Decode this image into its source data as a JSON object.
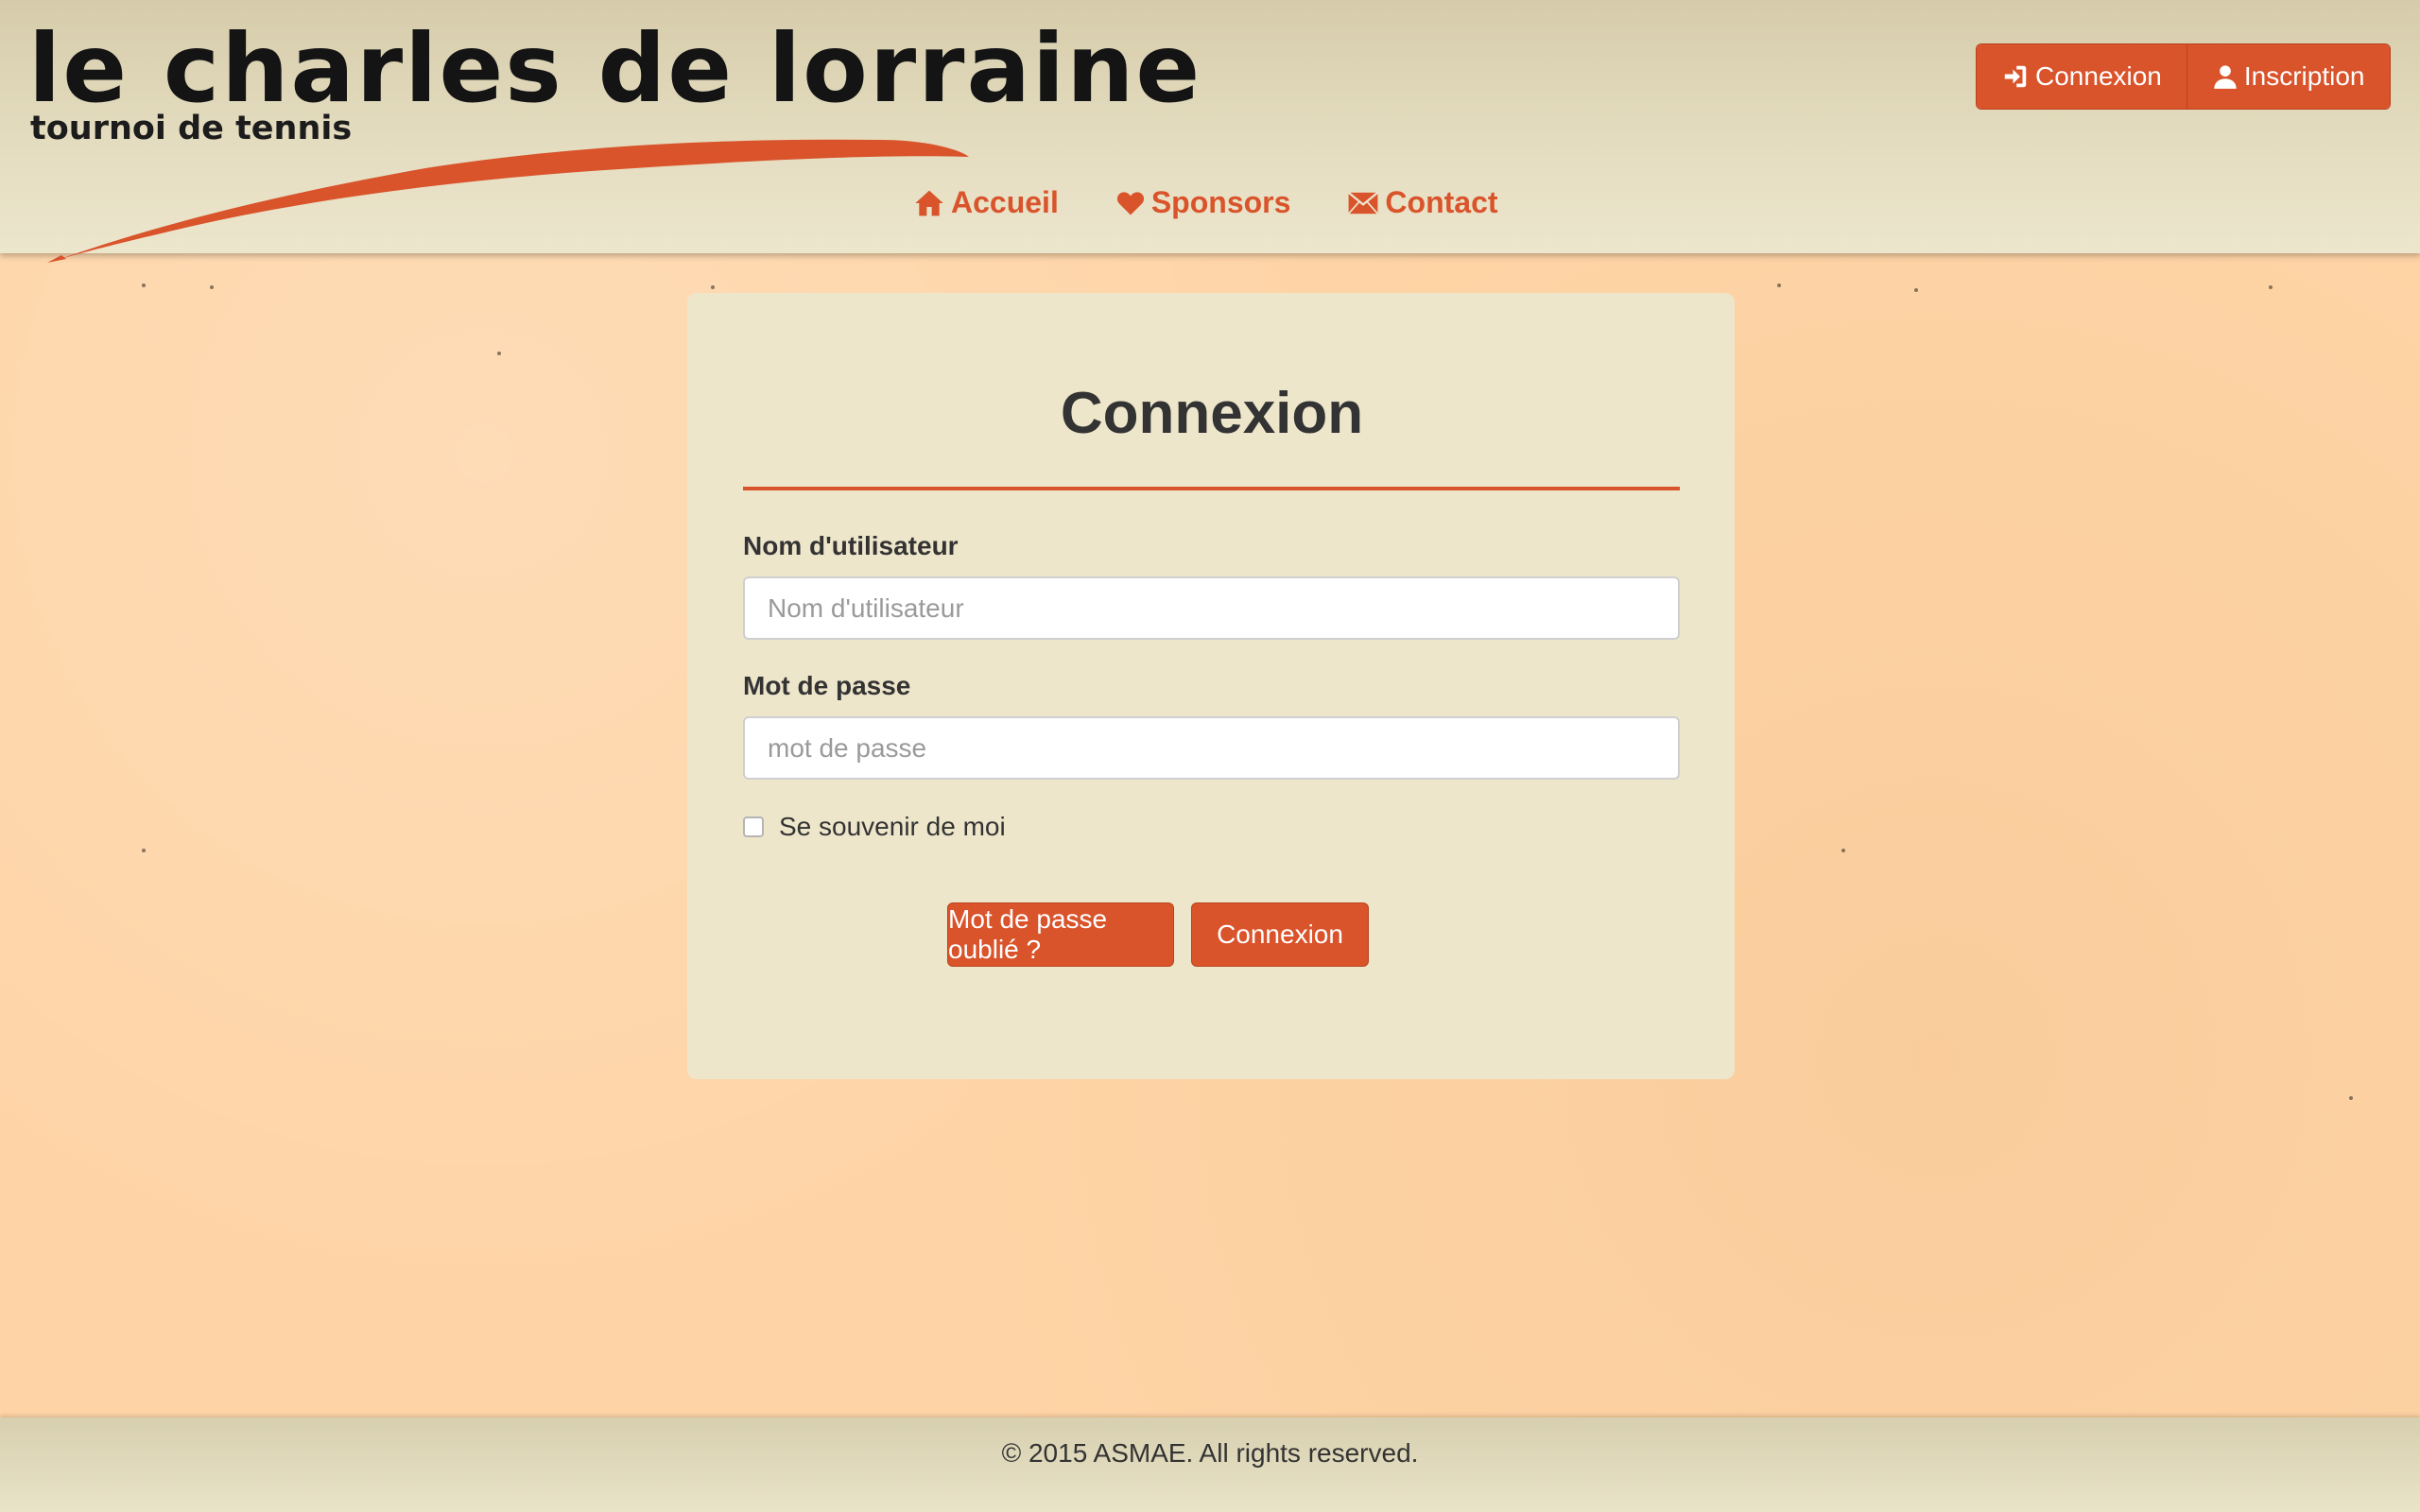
{
  "site": {
    "logo_title": "le charles de lorraine",
    "logo_subtitle": "tournoi de tennis",
    "accent_color": "#d9532b"
  },
  "header": {
    "login_label": "Connexion",
    "login_icon": "log-in-icon",
    "register_label": "Inscription",
    "register_icon": "user-icon"
  },
  "nav": {
    "home": {
      "label": "Accueil",
      "icon": "home-icon"
    },
    "sponsors": {
      "label": "Sponsors",
      "icon": "heart-icon"
    },
    "contact": {
      "label": "Contact",
      "icon": "envelope-icon"
    }
  },
  "form": {
    "title": "Connexion",
    "username_label": "Nom d'utilisateur",
    "username_placeholder": "Nom d'utilisateur",
    "username_value": "",
    "password_label": "Mot de passe",
    "password_placeholder": "mot de passe",
    "password_value": "",
    "remember_label": "Se souvenir de moi",
    "remember_checked": false,
    "forgot_button": "Mot de passe oublié ?",
    "submit_button": "Connexion"
  },
  "footer": {
    "copyright": "© 2015 ASMAE. All rights reserved."
  }
}
